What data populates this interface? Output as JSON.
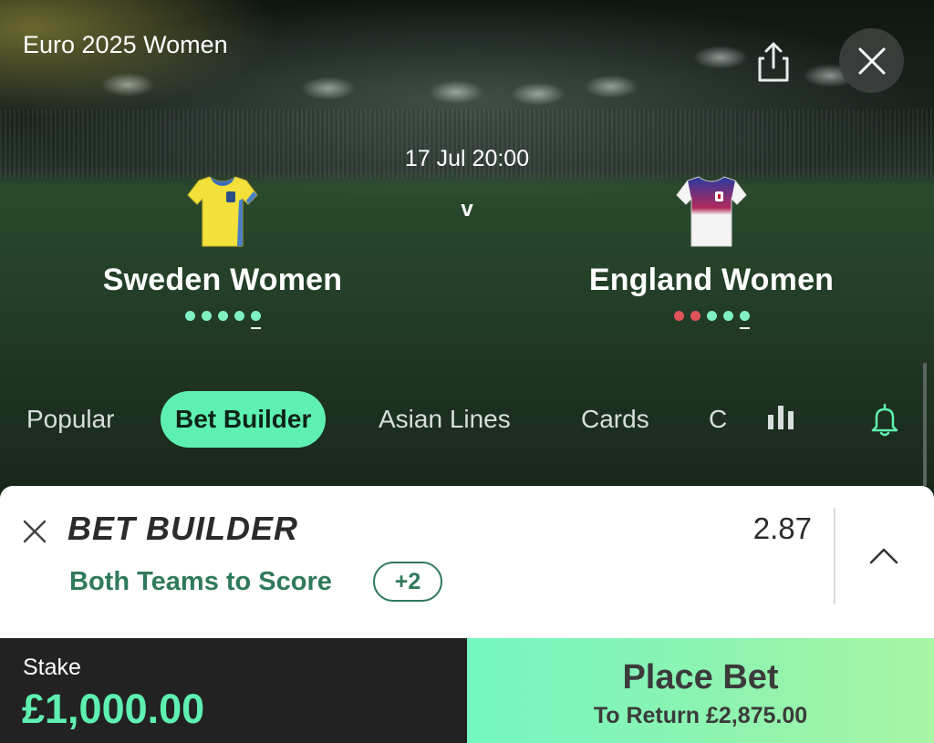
{
  "header": {
    "competition": "Euro 2025 Women",
    "share_icon": "share-icon",
    "close_icon": "close-icon"
  },
  "match": {
    "kickoff": "17 Jul 20:00",
    "versus": "v",
    "home": {
      "name": "Sweden Women",
      "kit_colors": {
        "primary": "#f3e03a",
        "accent": "#4a7fc4"
      },
      "form": [
        "win",
        "win",
        "win",
        "win",
        "win"
      ]
    },
    "away": {
      "name": "England Women",
      "kit_colors": {
        "primary": "#f4f4f4",
        "accent": "#2a3aa0"
      },
      "form": [
        "loss",
        "loss",
        "win",
        "win",
        "win"
      ]
    }
  },
  "tabs": [
    {
      "label": "Popular",
      "active": false
    },
    {
      "label": "Bet Builder",
      "active": true
    },
    {
      "label": "Asian Lines",
      "active": false
    },
    {
      "label": "Cards",
      "active": false
    },
    {
      "label": "C",
      "active": false
    }
  ],
  "bet_builder": {
    "title": "BET BUILDER",
    "odds": "2.87",
    "selection": "Both Teams to Score",
    "more_count": "+2"
  },
  "footer": {
    "stake_label": "Stake",
    "stake_value": "£1,000.00",
    "place_bet_label": "Place Bet",
    "to_return": "To Return £2,875.00"
  },
  "colors": {
    "accent": "#5ef0b0",
    "win": "#7ff0c2",
    "loss": "#e0525a",
    "selection_green": "#2f7a5c"
  }
}
